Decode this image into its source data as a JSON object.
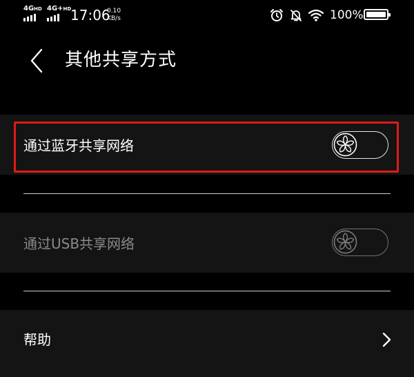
{
  "status_bar": {
    "sim1": "4G",
    "sim1_sup": "HD",
    "sim2": "4G+",
    "sim2_sup": "HD",
    "time": "17:06",
    "speed_value": "0.10",
    "speed_unit": "KB/s",
    "battery_percent": "100%",
    "icons": [
      "alarm-icon",
      "bell-off-icon",
      "wifi-icon",
      "battery-icon"
    ]
  },
  "header": {
    "title": "其他共享方式",
    "back_icon": "chevron-left-icon"
  },
  "settings": {
    "bluetooth_label": "通过蓝牙共享网络",
    "bluetooth_on": false,
    "usb_label": "通过USB共享网络",
    "usb_on": false,
    "usb_enabled": false,
    "help_label": "帮助",
    "help_icon": "chevron-right-icon"
  },
  "colors": {
    "background": "#000000",
    "row_background": "#141414",
    "highlight": "#e11a17",
    "disabled_text": "#8a8a8a"
  }
}
